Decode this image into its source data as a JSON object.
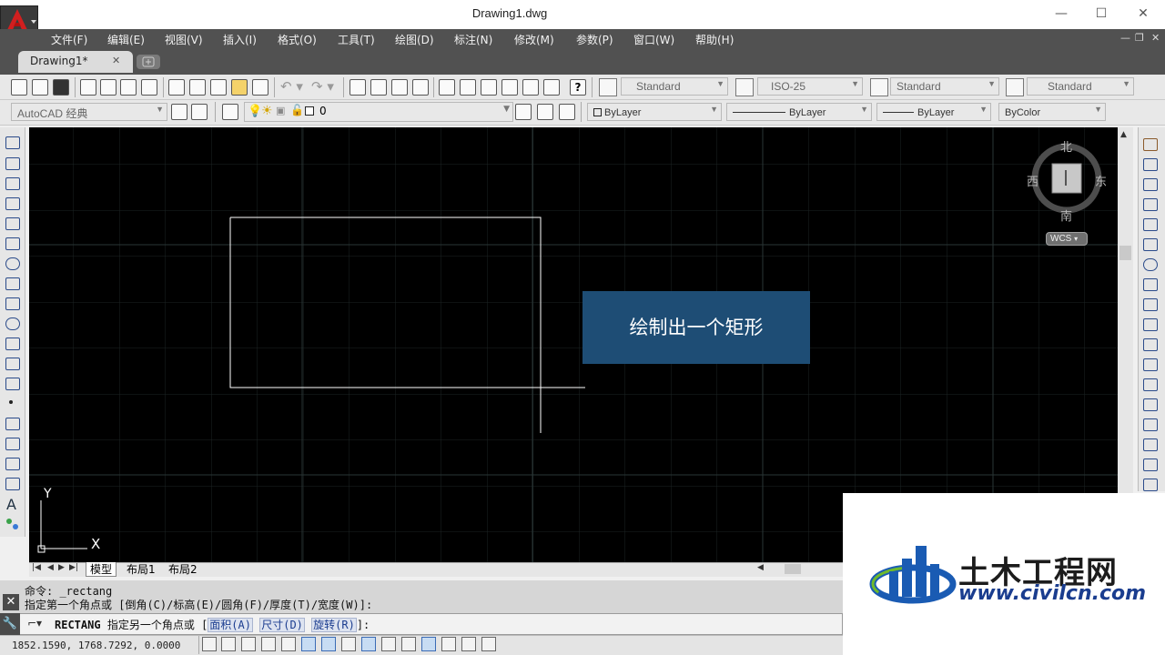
{
  "window": {
    "title": "Drawing1.dwg",
    "controls": {
      "minimize": "—",
      "maximize": "☐",
      "close": "✕"
    }
  },
  "menu": {
    "items": [
      "文件(F)",
      "编辑(E)",
      "视图(V)",
      "插入(I)",
      "格式(O)",
      "工具(T)",
      "绘图(D)",
      "标注(N)",
      "修改(M)",
      "参数(P)",
      "窗口(W)",
      "帮助(H)"
    ],
    "mdi_controls": {
      "minimize": "—",
      "restore": "❐",
      "close": "✕"
    }
  },
  "tabs": {
    "document": "Drawing1*",
    "close": "✕"
  },
  "toolbar": {
    "text_style": "Standard",
    "dim_style": "ISO-25",
    "table_style": "Standard",
    "multileader_style": "Standard",
    "workspace": "AutoCAD 经典",
    "layer": "0",
    "color": "ByLayer",
    "linetype": "ByLayer",
    "lineweight": "ByLayer",
    "plotstyle": "ByColor"
  },
  "viewcube": {
    "north": "北",
    "south": "南",
    "east": "东",
    "west": "西",
    "wcs": "WCS"
  },
  "ucs": {
    "x": "X",
    "y": "Y"
  },
  "caption": "绘制出一个矩形",
  "layout_tabs": [
    "模型",
    "布局1",
    "布局2"
  ],
  "command": {
    "history_1": "命令: _rectang",
    "history_2": "指定第一个角点或 [倒角(C)/标高(E)/圆角(F)/厚度(T)/宽度(W)]:",
    "current_cmd": "RECTANG",
    "prompt": "指定另一个角点或",
    "opt_area": "面积(A)",
    "opt_dims": "尺寸(D)",
    "opt_rotation": "旋转(R)",
    "open_bracket": "[",
    "close_bracket": "]:"
  },
  "status": {
    "coordinates": "1852.1590, 1768.7292, 0.0000"
  },
  "watermark": {
    "title": "土木工程网",
    "url": "www.civilcn.com"
  },
  "colors": {
    "canvas": "#000000",
    "grid": "#1f2a2a",
    "caption_bg": "#1e4d75",
    "menubar": "#515151",
    "watermark_blue": "#1a3d8f"
  }
}
